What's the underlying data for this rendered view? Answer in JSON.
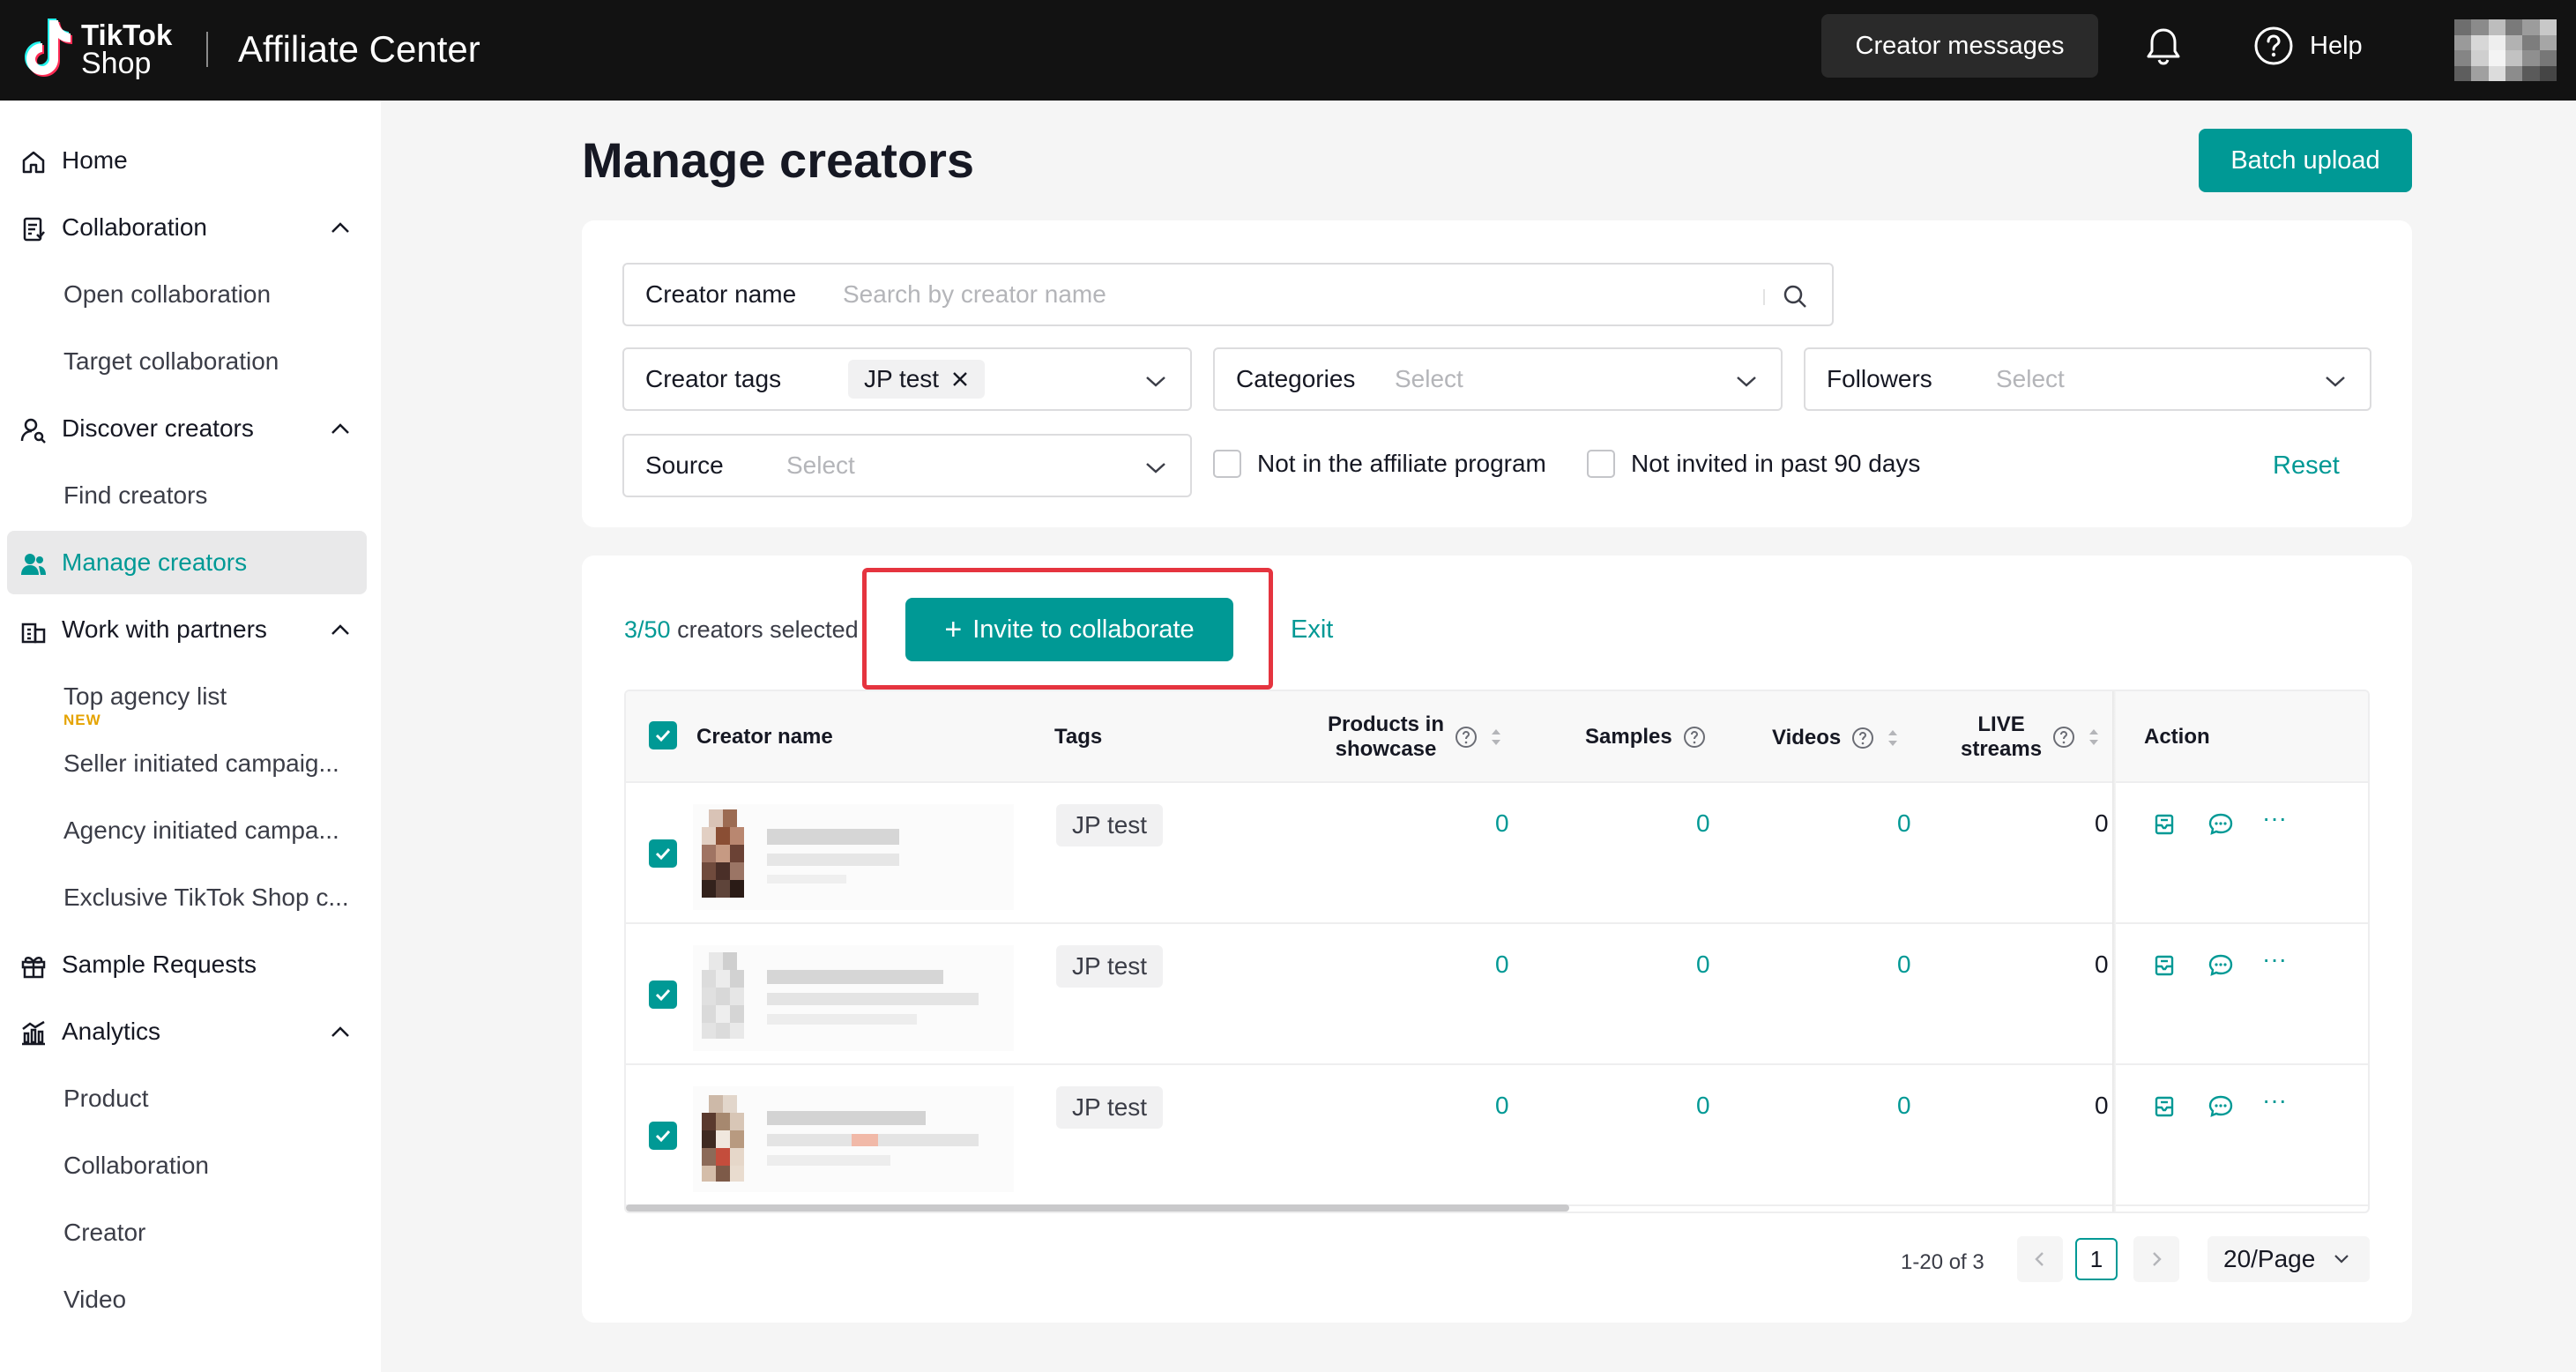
{
  "header": {
    "logo_line1": "TikTok",
    "logo_line2": "Shop",
    "app_title": "Affiliate Center",
    "creator_messages": "Creator messages",
    "help": "Help"
  },
  "sidebar": {
    "items": [
      {
        "label": "Home"
      },
      {
        "label": "Collaboration"
      },
      {
        "label": "Open collaboration"
      },
      {
        "label": "Target collaboration"
      },
      {
        "label": "Discover creators"
      },
      {
        "label": "Find creators"
      },
      {
        "label": "Manage creators"
      },
      {
        "label": "Work with partners"
      },
      {
        "label": "Top agency list"
      },
      {
        "label": "Seller initiated campaig..."
      },
      {
        "label": "Agency initiated campa..."
      },
      {
        "label": "Exclusive TikTok Shop c..."
      },
      {
        "label": "Sample Requests"
      },
      {
        "label": "Analytics"
      },
      {
        "label": "Product"
      },
      {
        "label": "Collaboration"
      },
      {
        "label": "Creator"
      },
      {
        "label": "Video"
      }
    ],
    "new_badge": "NEW"
  },
  "main": {
    "title": "Manage creators",
    "batch_upload": "Batch upload"
  },
  "filters": {
    "creator_name_label": "Creator name",
    "creator_name_placeholder": "Search by creator name",
    "creator_tags_label": "Creator tags",
    "creator_tags_value": "JP test",
    "categories_label": "Categories",
    "categories_placeholder": "Select",
    "followers_label": "Followers",
    "followers_placeholder": "Select",
    "source_label": "Source",
    "source_placeholder": "Select",
    "not_in_affiliate": "Not in the affiliate program",
    "not_invited": "Not invited in past 90 days",
    "reset": "Reset"
  },
  "selection": {
    "count": "3/50",
    "suffix": "creators selected",
    "invite": "Invite to collaborate",
    "exit": "Exit"
  },
  "table": {
    "headers": {
      "creator_name": "Creator name",
      "tags": "Tags",
      "products_line1": "Products in",
      "products_line2": "showcase",
      "samples": "Samples",
      "videos": "Videos",
      "live_line1": "LIVE",
      "live_line2": "streams",
      "action": "Action"
    },
    "rows": [
      {
        "tag": "JP test",
        "products": "0",
        "samples": "0",
        "videos": "0",
        "live": "0"
      },
      {
        "tag": "JP test",
        "products": "0",
        "samples": "0",
        "videos": "0",
        "live": "0"
      },
      {
        "tag": "JP test",
        "products": "0",
        "samples": "0",
        "videos": "0",
        "live": "0"
      }
    ],
    "action_more": "···"
  },
  "pagination": {
    "summary": "1-20 of 3",
    "current_page": "1",
    "page_size": "20/Page"
  },
  "colors": {
    "accent": "#009995",
    "header_bg": "#121212",
    "highlight": "#e5343f"
  }
}
